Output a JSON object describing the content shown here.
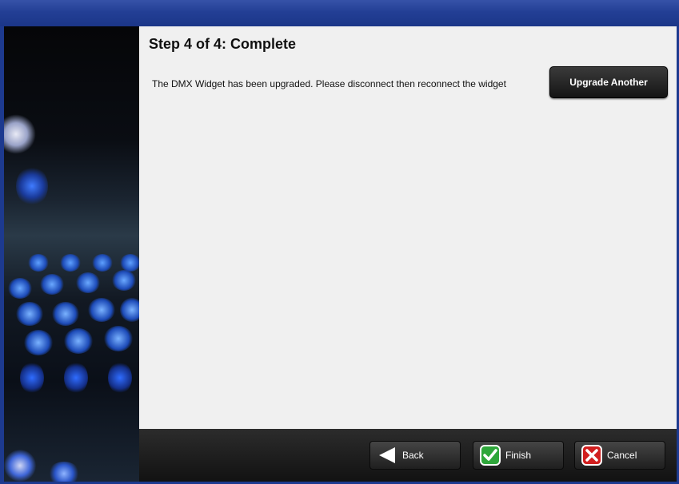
{
  "window": {
    "title": ""
  },
  "page": {
    "title": "Step 4 of 4: Complete",
    "message": "The DMX Widget has been upgraded. Please disconnect then reconnect the widget"
  },
  "actions": {
    "upgrade_another": "Upgrade Another"
  },
  "nav": {
    "back": "Back",
    "finish": "Finish",
    "cancel": "Cancel"
  },
  "icons": {
    "back": "back-arrow-icon",
    "finish": "checkmark-icon",
    "cancel": "x-icon"
  },
  "colors": {
    "titlebar": "#233f95",
    "finish_icon": "#2ea63a",
    "cancel_icon": "#d11f1f"
  }
}
